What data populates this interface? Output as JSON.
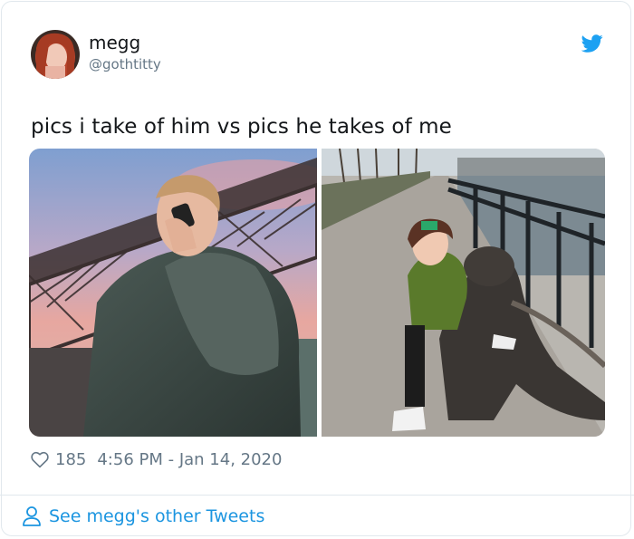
{
  "tweet": {
    "author_name": "megg",
    "author_handle": "@gothtitty",
    "text": "pics i take of him vs pics he takes of me",
    "likes": "185",
    "timestamp": "4:56 PM - Jan 14, 2020",
    "footer_link": "See megg's other Tweets"
  },
  "icons": {
    "brand": "twitter-bird-icon",
    "like": "heart-icon",
    "profile": "person-icon"
  },
  "colors": {
    "brand_blue": "#1da1f2",
    "link_blue": "#1b95e0",
    "muted_text": "#657786",
    "text": "#14171a"
  }
}
